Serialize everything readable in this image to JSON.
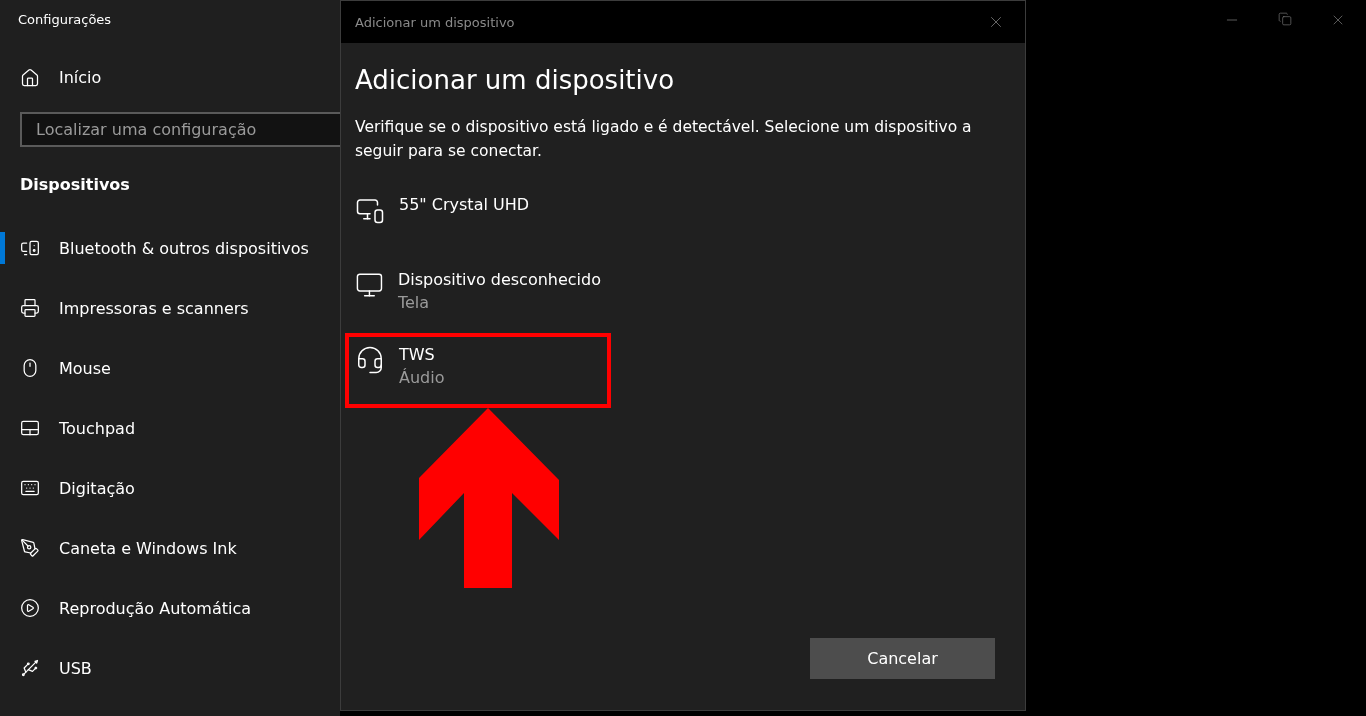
{
  "settings": {
    "title": "Configurações",
    "home": "Início",
    "search": {
      "placeholder": "Localizar uma configuração"
    },
    "section": "Dispositivos",
    "items": [
      {
        "label": "Bluetooth & outros dispositivos",
        "selected": true
      },
      {
        "label": "Impressoras e scanners",
        "selected": false
      },
      {
        "label": "Mouse",
        "selected": false
      },
      {
        "label": "Touchpad",
        "selected": false
      },
      {
        "label": "Digitação",
        "selected": false
      },
      {
        "label": "Caneta e Windows Ink",
        "selected": false
      },
      {
        "label": "Reprodução Automática",
        "selected": false
      },
      {
        "label": "USB",
        "selected": false
      }
    ]
  },
  "dialog": {
    "title": "Adicionar um dispositivo",
    "heading": "Adicionar um dispositivo",
    "description": "Verifique se o dispositivo está ligado e é detectável. Selecione um dispositivo a seguir para se conectar.",
    "devices": [
      {
        "name": "55\" Crystal UHD",
        "annotated": false
      },
      {
        "name": "Dispositivo desconhecido",
        "type": "Tela",
        "annotated": false
      },
      {
        "name": "TWS",
        "type": "Áudio",
        "annotated": true
      }
    ],
    "button": "Cancelar"
  }
}
